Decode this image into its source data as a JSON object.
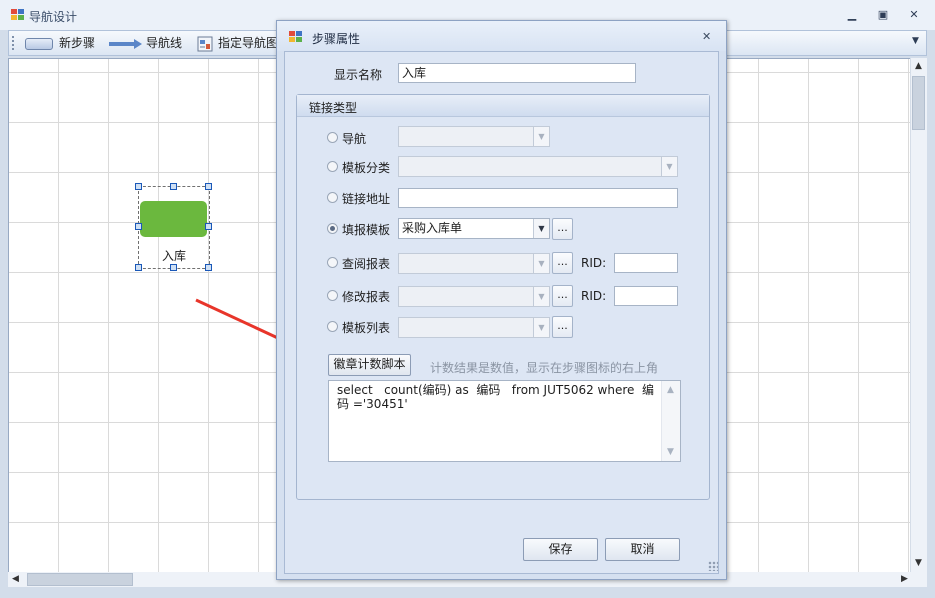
{
  "main_window": {
    "title": "导航设计",
    "toolbar": {
      "new_step": "新步骤",
      "nav_line": "导航线",
      "set_nav_image": "指定导航图"
    },
    "canvas": {
      "step_node_label": "入库"
    }
  },
  "dialog": {
    "title": "步骤属性",
    "display_name_label": "显示名称",
    "display_name_value": "入库",
    "link_group_title": "链接类型",
    "link_options": {
      "nav": "导航",
      "template_category": "模板分类",
      "link_url": "链接地址",
      "fill_template": "填报模板",
      "fill_template_value": "采购入库单",
      "view_report": "查阅报表",
      "edit_report": "修改报表",
      "template_list": "模板列表",
      "rid_label": "RID:",
      "ellipsis": "..."
    },
    "selected_option": "fill_template",
    "script_button": "徽章计数脚本",
    "script_hint": "计数结果是数值，显示在步骤图标的右上角",
    "script_text": "select   count(编码) as  编码   from JUT5062 where  编码 ='30451'",
    "save_button": "保存",
    "cancel_button": "取消"
  },
  "colors": {
    "step_fill": "#6bb83e",
    "arrow": "#e8352a",
    "accent_blue": "#3f74c4"
  }
}
